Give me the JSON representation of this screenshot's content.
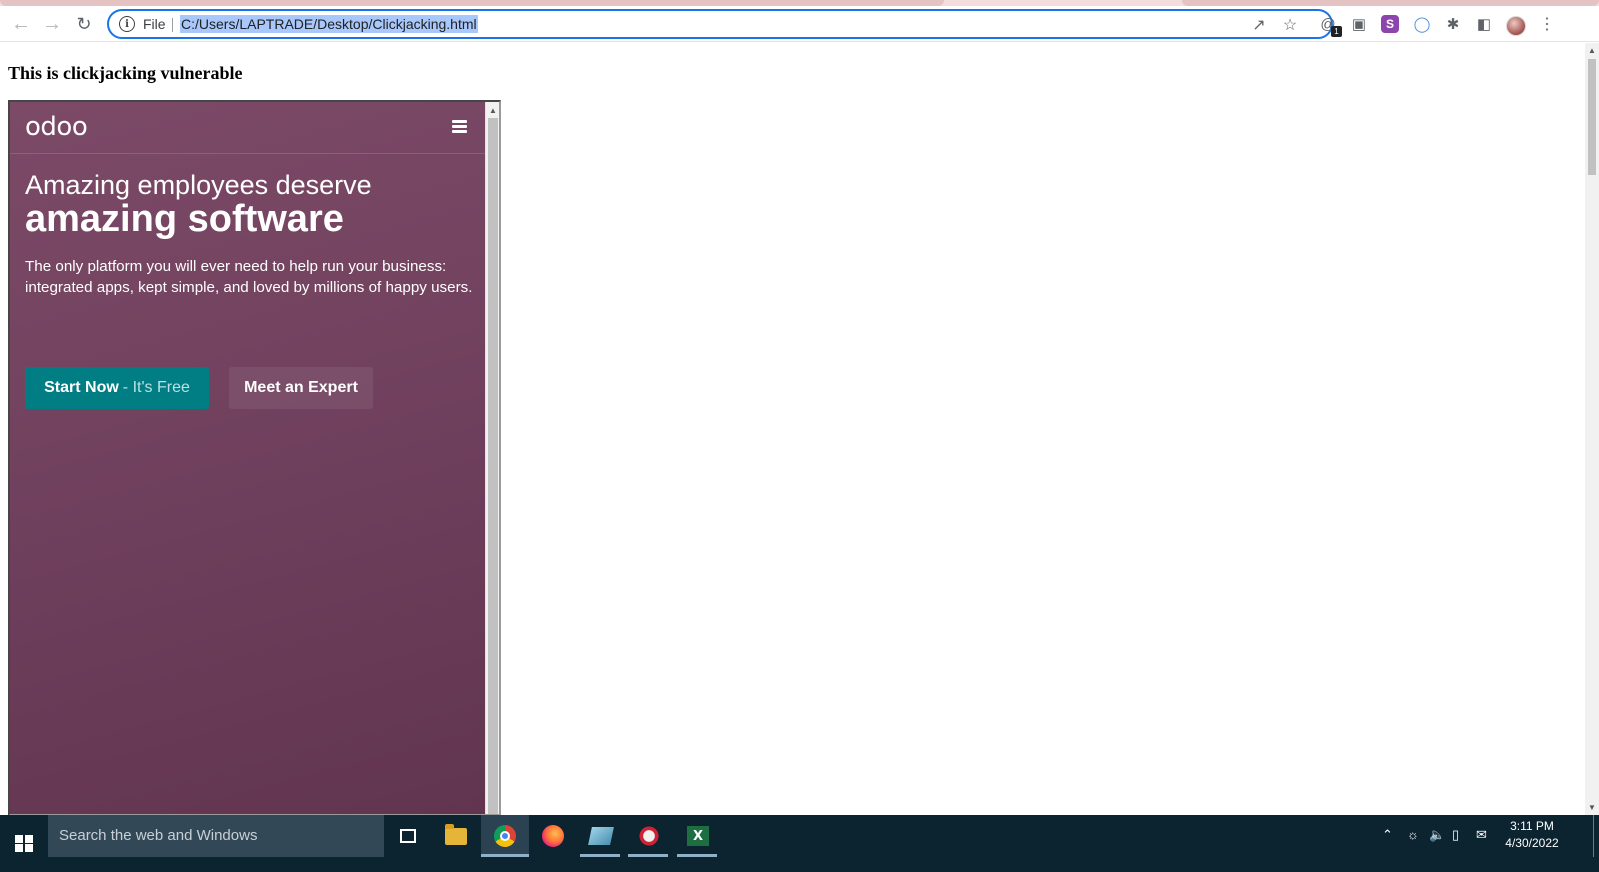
{
  "browser": {
    "omnibox": {
      "scheme_label": "File",
      "url": "C:/Users/LAPTRADE/Desktop/Clickjacking.html"
    },
    "extension_badge": "1",
    "extension_s_label": "S"
  },
  "page": {
    "heading": "This is clickjacking vulnerable"
  },
  "embedded_site": {
    "logo_text": "odoo",
    "hero_line1": "Amazing employees deserve",
    "hero_line2": "amazing software",
    "description": "The only platform you will ever need to help run your business: integrated apps, kept simple, and loved by millions of happy users.",
    "start_button": {
      "main": "Start Now",
      "suffix": "- It's Free"
    },
    "expert_button": "Meet an Expert",
    "colors": {
      "background": "#714b67",
      "primary_button": "#017e84"
    }
  },
  "taskbar": {
    "search_placeholder": "Search the web and Windows",
    "clock_time": "3:11 PM",
    "clock_date": "4/30/2022",
    "apps": [
      "task-view",
      "file-explorer",
      "chrome",
      "firefox",
      "generic-app",
      "snipping-tool",
      "excel"
    ]
  }
}
